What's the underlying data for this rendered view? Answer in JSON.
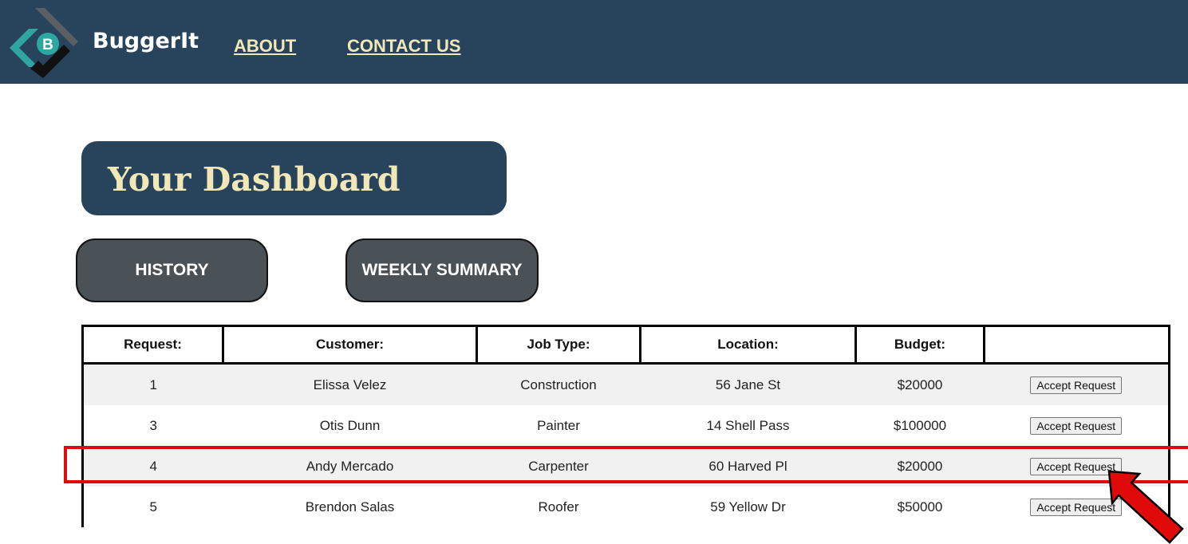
{
  "navbar": {
    "brand": "BuggerIt",
    "logo_letter": "B",
    "links": [
      {
        "label": "ABOUT"
      },
      {
        "label": "CONTACT US"
      }
    ]
  },
  "dashboard": {
    "title": "Your Dashboard",
    "tabs": [
      {
        "label": "HISTORY"
      },
      {
        "label": "WEEKLY SUMMARY"
      }
    ]
  },
  "table": {
    "headers": [
      "Request:",
      "Customer:",
      "Job Type:",
      "Location:",
      "Budget:",
      ""
    ],
    "rows": [
      {
        "request": "1",
        "customer": "Elissa Velez",
        "job_type": "Construction",
        "location": "56 Jane St",
        "budget": "$20000",
        "action": "Accept Request"
      },
      {
        "request": "3",
        "customer": "Otis Dunn",
        "job_type": "Painter",
        "location": "14 Shell Pass",
        "budget": "$100000",
        "action": "Accept Request"
      },
      {
        "request": "4",
        "customer": "Andy Mercado",
        "job_type": "Carpenter",
        "location": "60 Harved Pl",
        "budget": "$20000",
        "action": "Accept Request"
      },
      {
        "request": "5",
        "customer": "Brendon Salas",
        "job_type": "Roofer",
        "location": "59 Yellow Dr",
        "budget": "$50000",
        "action": "Accept Request"
      }
    ]
  },
  "colors": {
    "navbar_bg": "#27445c",
    "accent_text": "#f2e8b7",
    "tab_bg": "#4a5157",
    "highlight": "#e10a0a",
    "logo_teal": "#2ea7a2"
  },
  "annotation": {
    "highlighted_row_request": "4",
    "arrow_target": "accept-request-button-row-4"
  }
}
